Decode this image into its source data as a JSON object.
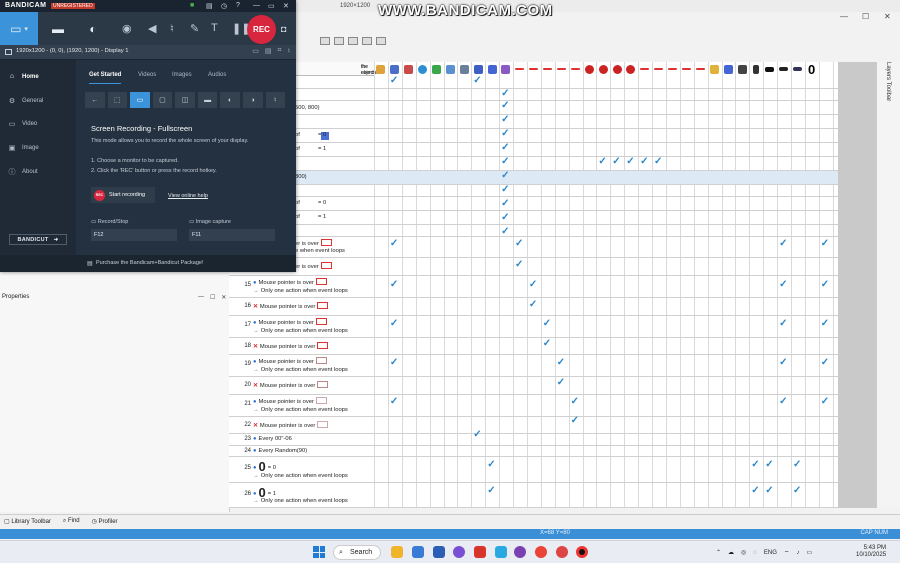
{
  "watermark": {
    "text": "WWW.BANDICAM.COM",
    "left_mini": "1920×1200",
    "right_mini": "REC"
  },
  "bandicam": {
    "logo": "BANDICAM",
    "badge": "UNREGISTERED",
    "rec_label": "REC",
    "display_label": "1920x1200 - (0, 0), (1920, 1200) - Display 1",
    "sidebar": [
      {
        "label": "Home",
        "icon": "home-icon",
        "active": true
      },
      {
        "label": "General",
        "icon": "gear-icon",
        "active": false
      },
      {
        "label": "Video",
        "icon": "video-icon",
        "active": false
      },
      {
        "label": "Image",
        "icon": "image-icon",
        "active": false
      },
      {
        "label": "About",
        "icon": "info-icon",
        "active": false
      }
    ],
    "bandicut_label": "BANDICUT",
    "tabs": [
      "Get Started",
      "Videos",
      "Images",
      "Audios"
    ],
    "mode_title": "Screen Recording - Fullscreen",
    "mode_desc": "This mode allows you to record the whole screen of your display.",
    "step1": "1. Choose a monitor to be captured.",
    "step2": "2. Click the 'REC' button or press the record hotkey.",
    "start_btn": "Start recording",
    "start_badge": "REC",
    "online_help": "View online help",
    "record_stop_label": "Record/Stop",
    "record_stop_key": "F12",
    "image_capture_label": "Image capture",
    "image_capture_key": "F11",
    "footer": "Purchase the Bandicam+Bandicut Package!"
  },
  "editor": {
    "events_header_line1": "the events",
    "events_header_line2": "the objects",
    "frag_row3": "500, 800)",
    "frag_of": "of",
    "frag_eq0": "= 0",
    "frag_eq1": "= 1",
    "frag_row7": "800)",
    "frag_over": "er is over",
    "frag_loops": "e when event loops",
    "mouse_over": "Mouse pointer is over",
    "only_one": "Only one action when event loops",
    "every": "Every 00\"-06",
    "every_random": "Every Random(90)",
    "big_zero": "0",
    "eq0": "= 0",
    "eq1": "= 1",
    "rows": [
      {
        "num": "15"
      },
      {
        "num": "16"
      },
      {
        "num": "17"
      },
      {
        "num": "18"
      },
      {
        "num": "19"
      },
      {
        "num": "20"
      },
      {
        "num": "21"
      },
      {
        "num": "22"
      },
      {
        "num": "23"
      },
      {
        "num": "24"
      },
      {
        "num": "25"
      },
      {
        "num": "26"
      }
    ],
    "properties_label": "Properties",
    "layers_toolbar": "Layers Toolbar",
    "bottom_tabs": [
      "Library Toolbar",
      "Find",
      "Profiler"
    ],
    "status_left": "X=68  Y=80",
    "status_right": "CAP  NUM",
    "col_zero": "0"
  },
  "taskbar": {
    "search": "Search",
    "lang": "ENG",
    "time": "5:43 PM",
    "date": "10/10/2025"
  }
}
